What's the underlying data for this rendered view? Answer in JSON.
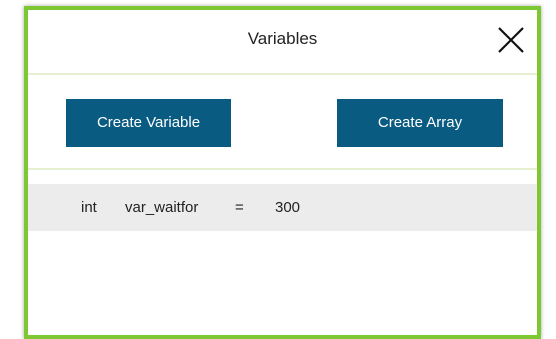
{
  "dialog": {
    "title": "Variables",
    "close_icon": "close-x-icon",
    "accent_color": "#7cc832"
  },
  "actions": {
    "create_variable_label": "Create Variable",
    "create_array_label": "Create Array",
    "button_color": "#0a5b82"
  },
  "variables": [
    {
      "type": "int",
      "name": "var_waitfor",
      "operator": "=",
      "value": "300"
    }
  ]
}
